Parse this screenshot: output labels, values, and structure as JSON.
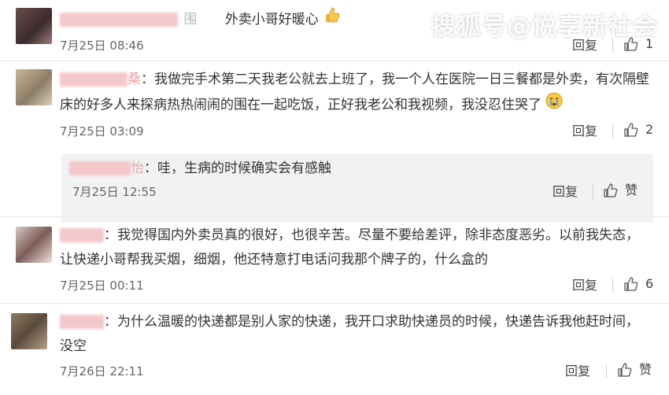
{
  "watermark": "搜狐号@悦享新社会",
  "comments": [
    {
      "name": "",
      "name_tail": "围",
      "text": "外卖小哥好暖心",
      "time": "7月25日 08:46",
      "reply_label": "回复",
      "likes": "1"
    },
    {
      "name": "",
      "name_tail": "桑",
      "text_line1": "：我做完手术第二天我老公就去上班了，我一个人在医院一日三餐都是外卖，有次隔壁",
      "text_line2": "床的好多人来探病热热闹闹的围在一起吃饭，正好我老公和我视频，我没忍住哭了",
      "time": "7月25日 03:09",
      "reply_label": "回复",
      "likes": "2",
      "sub_reply": {
        "name": "",
        "name_tail": "怡",
        "text": "：哇，生病的时候确实会有感触",
        "time": "7月25日 12:55",
        "reply_label": "回复",
        "like_label": "赞"
      }
    },
    {
      "name": "",
      "text_line1": "：我觉得国内外卖员真的很好，也很辛苦。尽量不要给差评，除非态度恶劣。以前我失态，",
      "text_line2": "让快递小哥帮我买烟，细烟，他还特意打电话问我那个牌子的，什么盒的",
      "time": "7月25日 00:11",
      "reply_label": "回复",
      "likes": "6"
    },
    {
      "name": "",
      "text_line1": "：为什么温暖的快递都是别人家的快递，我开口求助快递员的时候，快递告诉我他赶时间，",
      "text_line2": "没空",
      "time": "7月26日 22:11",
      "reply_label": "回复",
      "like_label": "赞"
    }
  ],
  "colors": {
    "name_blur": "#e8a0a4",
    "bg": "#ffffff",
    "reply_bg": "#f2f2f2"
  }
}
